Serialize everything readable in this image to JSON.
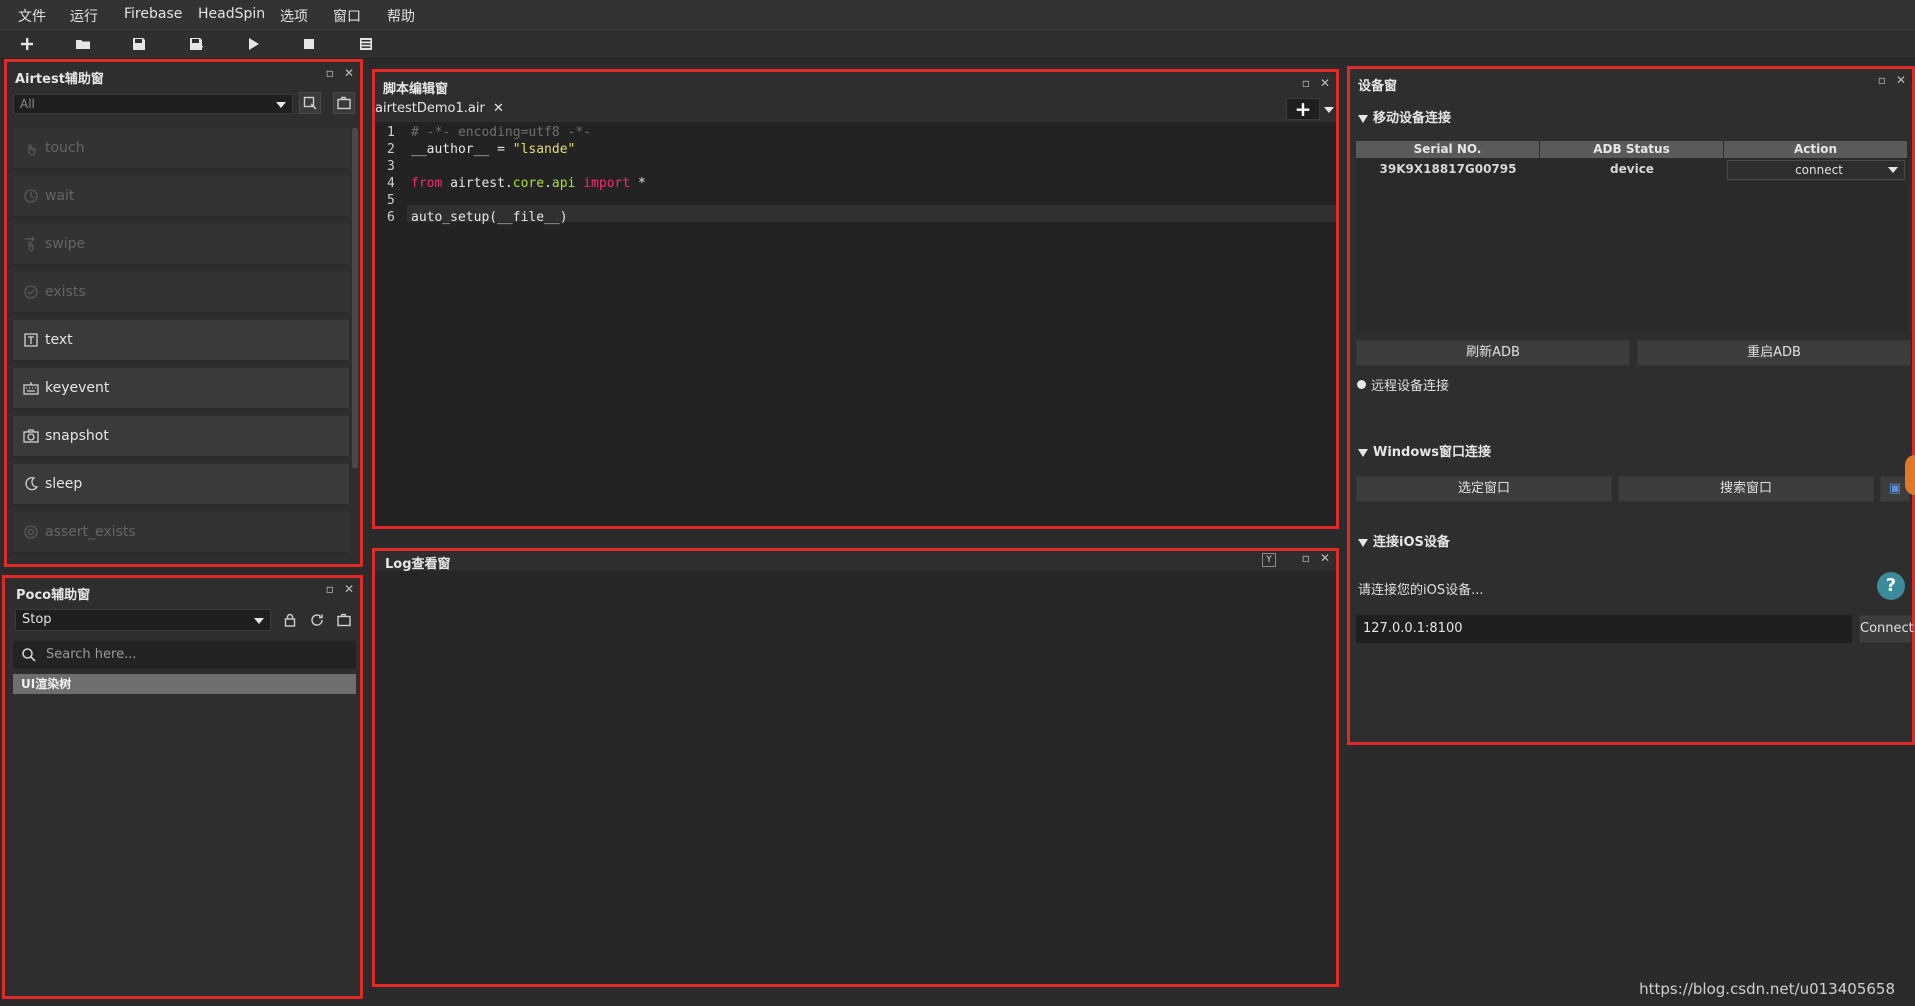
{
  "menu": [
    "文件",
    "运行",
    "Firebase",
    "HeadSpin",
    "选项",
    "窗口",
    "帮助"
  ],
  "toolbar_icons": [
    "new-icon",
    "open-folder-icon",
    "save-icon",
    "save-as-icon",
    "play-icon",
    "stop-icon",
    "list-icon"
  ],
  "airtest": {
    "title": "Airtest辅助窗",
    "filter": "All",
    "items": [
      {
        "label": "touch",
        "enabled": false,
        "icon": "touch-icon"
      },
      {
        "label": "wait",
        "enabled": false,
        "icon": "clock-icon"
      },
      {
        "label": "swipe",
        "enabled": false,
        "icon": "swipe-icon"
      },
      {
        "label": "exists",
        "enabled": false,
        "icon": "check-circle-icon"
      },
      {
        "label": "text",
        "enabled": true,
        "icon": "text-icon"
      },
      {
        "label": "keyevent",
        "enabled": true,
        "icon": "keyboard-icon"
      },
      {
        "label": "snapshot",
        "enabled": true,
        "icon": "camera-icon"
      },
      {
        "label": "sleep",
        "enabled": true,
        "icon": "moon-icon"
      },
      {
        "label": "assert_exists",
        "enabled": false,
        "icon": "target-icon"
      }
    ]
  },
  "poco": {
    "title": "Poco辅助窗",
    "mode": "Stop",
    "search_placeholder": "Search here...",
    "tree_root": "UI渲染树"
  },
  "editor": {
    "title": "脚本编辑窗",
    "tab": "airtestDemo1.air",
    "tab_close": "✕",
    "lines": [
      {
        "n": "1",
        "text": "# -*- encoding=utf8 -*-"
      },
      {
        "n": "2",
        "text": "__author__ = \"lsande\""
      },
      {
        "n": "3",
        "text": ""
      },
      {
        "n": "4",
        "text": "from airtest.core.api import *"
      },
      {
        "n": "5",
        "text": ""
      },
      {
        "n": "6",
        "text": "auto_setup(__file__)"
      }
    ]
  },
  "log": {
    "title": "Log查看窗"
  },
  "device": {
    "title": "设备窗",
    "mobile_section": "移动设备连接",
    "table": {
      "headers": [
        "Serial NO.",
        "ADB Status",
        "Action"
      ],
      "rows": [
        {
          "serial": "39K9X18817G00795",
          "status": "device",
          "action": "connect"
        }
      ]
    },
    "refresh_adb": "刷新ADB",
    "restart_adb": "重启ADB",
    "remote_section": "远程设备连接",
    "windows_section": "Windows窗口连接",
    "select_window": "选定窗口",
    "search_window": "搜索窗口",
    "ios_section": "连接iOS设备",
    "ios_hint": "请连接您的iOS设备...",
    "ios_address": "127.0.0.1:8100",
    "ios_connect": "Connect"
  },
  "watermark": "https://blog.csdn.net/u013405658"
}
